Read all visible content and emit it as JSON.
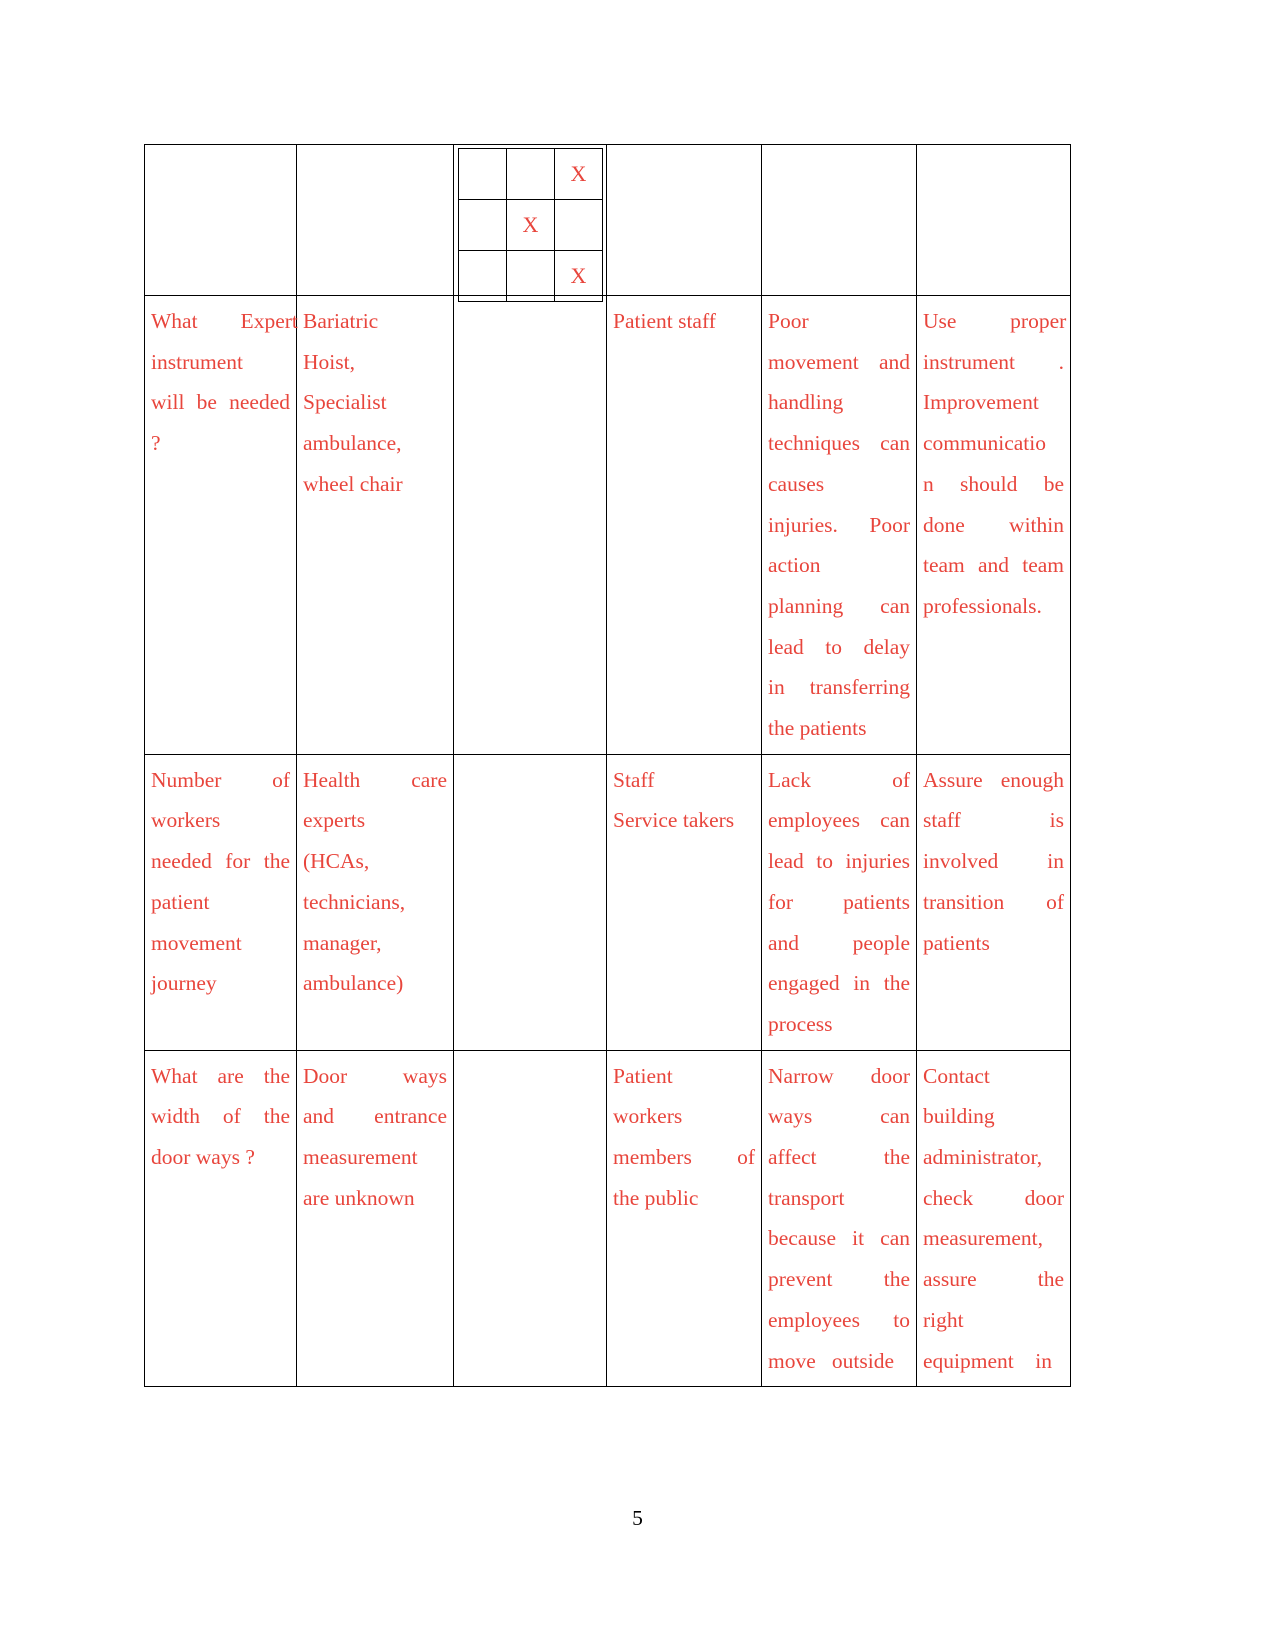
{
  "document": {
    "page_number": "5",
    "text_color": "#e8453c",
    "border_color": "#000000",
    "page_number_color": "#000000"
  },
  "mini_grid": {
    "rows": 3,
    "cols": 3,
    "mark": "X",
    "cells": [
      [
        "",
        "",
        "X"
      ],
      [
        "",
        "X",
        ""
      ],
      [
        "",
        "",
        "X"
      ]
    ]
  },
  "table": {
    "rows": [
      {
        "type": "grid-row",
        "cells": [
          "",
          "",
          "GRID",
          "",
          "",
          ""
        ]
      },
      {
        "type": "text-row",
        "cells": [
          {
            "lines": [
              "What        Expert",
              "instrument",
              "will  be  needed",
              "?"
            ]
          },
          {
            "lines": [
              "Bariatric",
              "Hoist,",
              "Specialist",
              "ambulance,",
              "wheel chair"
            ]
          },
          {
            "lines": []
          },
          {
            "lines": [
              "Patient staff"
            ]
          },
          {
            "lines": [
              "Poor",
              "movement  and",
              "handling",
              "techniques  can",
              "causes",
              "injuries.     Poor",
              "action",
              "planning      can",
              "lead   to   delay",
              "in  transferring",
              "the patients"
            ]
          },
          {
            "lines": [
              "Use          proper",
              "instrument .",
              "Improvement",
              "communicatio",
              "n    should    be",
              "done        within",
              "team and team",
              "professionals."
            ]
          }
        ]
      },
      {
        "type": "text-row",
        "cells": [
          {
            "lines": [
              "Number         of",
              "workers",
              "needed  for  the",
              "patient",
              "movement",
              "journey"
            ]
          },
          {
            "lines": [
              "Health      care",
              "experts",
              "(HCAs,",
              "technicians,",
              "manager,",
              "ambulance)"
            ]
          },
          {
            "lines": []
          },
          {
            "lines": [
              "Staff",
              "Service takers"
            ]
          },
          {
            "lines": [
              "Lack           of",
              "employees  can",
              "lead to injuries",
              "for      patients",
              "and       people",
              "engaged  in  the",
              "process"
            ]
          },
          {
            "lines": [
              "Assure enough",
              "staff            is",
              "involved       in",
              "transition     of",
              "patients"
            ]
          }
        ]
      },
      {
        "type": "text-row",
        "cells": [
          {
            "lines": [
              "What   are   the",
              "width   of   the",
              "door ways ?"
            ]
          },
          {
            "lines": [
              "Door       ways",
              "and     entrance",
              "measurement",
              "are unknown"
            ]
          },
          {
            "lines": []
          },
          {
            "lines": [
              "Patient",
              "workers",
              "members      of",
              "the public"
            ]
          },
          {
            "lines": [
              "Narrow     door",
              "ways        can",
              "affect        the",
              "transport",
              "because  it  can",
              "prevent       the",
              "employees    to",
              "move   outside"
            ]
          },
          {
            "lines": [
              "Contact",
              "building",
              "administrator,",
              "check       door",
              "measurement,",
              "assure        the",
              "right",
              "equipment    in"
            ]
          }
        ]
      }
    ]
  }
}
